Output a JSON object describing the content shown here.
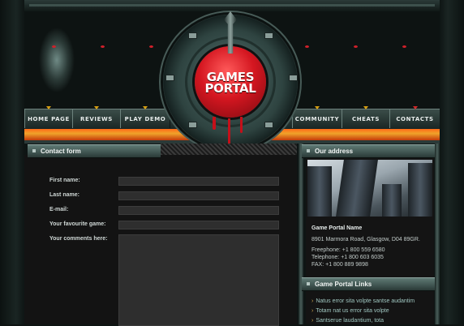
{
  "logo": {
    "line1": "GAMES",
    "line2": "PORTAL"
  },
  "nav": [
    {
      "label": "HOME PAGE"
    },
    {
      "label": "REVIEWS"
    },
    {
      "label": "PLAY DEMO"
    },
    {
      "label": "COMMUNITY"
    },
    {
      "label": "CHEATS"
    },
    {
      "label": "CONTACTS"
    }
  ],
  "contact": {
    "title": "Contact form",
    "fields": [
      {
        "label": "First name:"
      },
      {
        "label": "Last name:"
      },
      {
        "label": "E-mail:"
      },
      {
        "label": "Your favourite game:"
      },
      {
        "label": "Your comments here:"
      }
    ]
  },
  "address": {
    "title": "Our address",
    "name": "Game Portal Name",
    "street": "8901 Marmora Road, Glasgow, D04 89GR.",
    "freephone": "Freephone:   +1 800 559 6580",
    "telephone": "Telephone:   +1 800 603 6035",
    "fax": "FAX:           +1 800 889 9898"
  },
  "links": {
    "title": "Game Portal Links",
    "items": [
      "Natus error sita volpte santse audantim",
      "Totam nat us error sita volpte",
      "Santserue laudantium, tota"
    ]
  },
  "colors": {
    "accent": "#ff7a1a",
    "logo_red": "#d41620",
    "panel": "#131313"
  }
}
